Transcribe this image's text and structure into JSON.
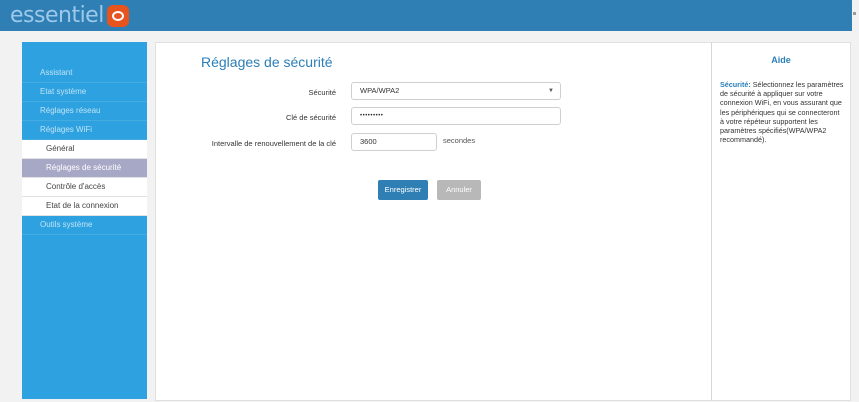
{
  "brand": {
    "logo_text": "essentiel"
  },
  "sidebar": {
    "items": [
      {
        "label": "Assistant"
      },
      {
        "label": "Etat système"
      },
      {
        "label": "Réglages réseau"
      },
      {
        "label": "Réglages WiFi"
      }
    ],
    "submenu": [
      {
        "label": "Général"
      },
      {
        "label": "Réglages de sécurité"
      },
      {
        "label": "Contrôle d'accès"
      },
      {
        "label": "Etat de la connexion"
      }
    ],
    "after": [
      {
        "label": "Outils système"
      }
    ]
  },
  "main": {
    "title": "Réglages de sécurité",
    "security_label": "Sécurité",
    "security_value": "WPA/WPA2",
    "key_label": "Clé de sécurité",
    "key_value": "•••••••••",
    "interval_label": "Intervalle de renouvellement de la clé",
    "interval_value": "3600",
    "interval_unit": "secondes",
    "save_label": "Enregistrer",
    "cancel_label": "Annuler"
  },
  "help": {
    "title": "Aide",
    "term": "Sécurité:",
    "text": " Sélectionnez les paramètres de sécurité à appliquer sur votre connexion WiFi, en vous assurant que les périphériques qui se connecteront à votre répéteur supportent les paramètres spécifiés(WPA/WPA2 recommandé)."
  },
  "colors": {
    "topbar": "#2f7fb5",
    "sidebar": "#2ea2e0",
    "accent": "#2a7fb8",
    "logo_badge": "#e8541e",
    "active_item": "#a7a7c6"
  }
}
